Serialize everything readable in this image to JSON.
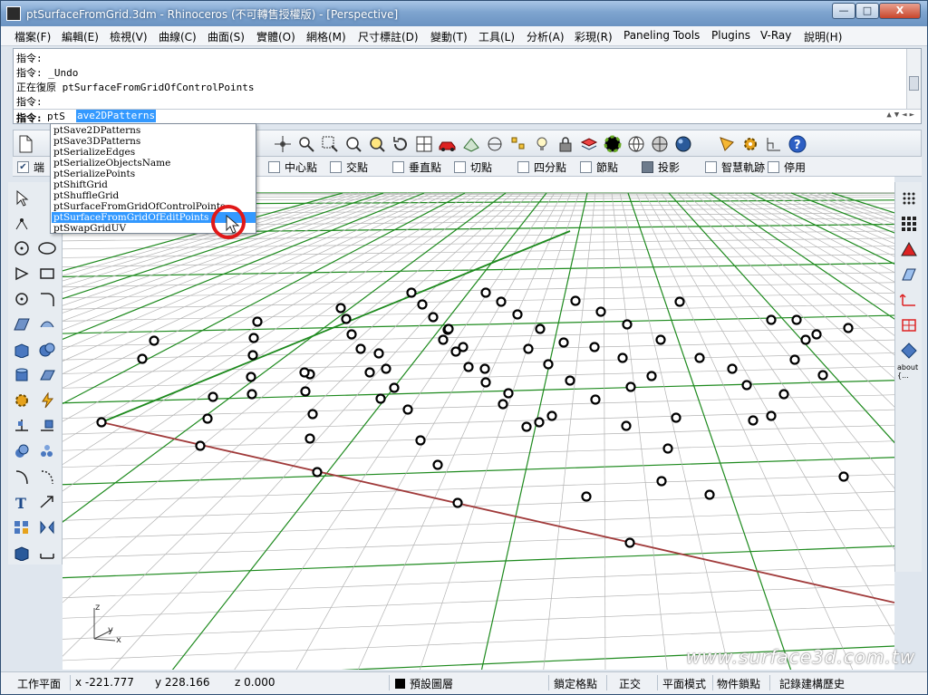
{
  "window": {
    "title": "ptSurfaceFromGrid.3dm - Rhinoceros (不可轉售授權版) - [Perspective]",
    "minimize": "—",
    "maximize": "□",
    "close": "X"
  },
  "menu": [
    "檔案(F)",
    "編輯(E)",
    "檢視(V)",
    "曲線(C)",
    "曲面(S)",
    "實體(O)",
    "網格(M)",
    "尺寸標註(D)",
    "變動(T)",
    "工具(L)",
    "分析(A)",
    "彩現(R)",
    "Paneling Tools",
    "Plugins",
    "V-Ray",
    "說明(H)"
  ],
  "command_history": [
    "指令:",
    "指令: _Undo",
    "正在復原 ptSurfaceFromGridOfControlPoints",
    "指令:"
  ],
  "command_line": {
    "prompt": "指令:",
    "typed": "ptS",
    "selected": "ave2DPatterns"
  },
  "autocomplete": {
    "items": [
      "ptSave2DPatterns",
      "ptSave3DPatterns",
      "ptSerializeEdges",
      "ptSerializeObjectsName",
      "ptSerializePoints",
      "ptShiftGrid",
      "ptShuffleGrid",
      "ptSurfaceFromGridOfControlPoints",
      "ptSurfaceFromGridOfEditPoints",
      "ptSwapGridUV"
    ],
    "selected_index": 8
  },
  "osnap": {
    "end_label": "端",
    "items": [
      {
        "label": "中心點",
        "checked": false
      },
      {
        "label": "交點",
        "checked": false
      },
      {
        "label": "垂直點",
        "checked": false
      },
      {
        "label": "切點",
        "checked": false
      },
      {
        "label": "四分點",
        "checked": false
      },
      {
        "label": "節點",
        "checked": false
      },
      {
        "label": "投影",
        "checked": false
      },
      {
        "label": "智慧軌跡",
        "checked": false
      },
      {
        "label": "停用",
        "checked": false
      }
    ]
  },
  "right_toolbar": {
    "about_label": "about",
    "about_sub": "{..."
  },
  "axes": {
    "z": "z",
    "y": "y",
    "x": "x"
  },
  "watermark": "www.surface3d.com.tw",
  "status": {
    "cplane": "工作平面",
    "x": "x -221.777",
    "y": "y 228.166",
    "z": "z 0.000",
    "layer": "預設圖層",
    "grid_snap": "鎖定格點",
    "ortho": "正交",
    "planar": "平面模式",
    "osnap": "物件鎖點",
    "history": "記錄建構歷史"
  },
  "colors": {
    "grid_major": "#1e8a1e",
    "grid_minor": "#b4b4b4",
    "x_axis": "#a03a3a",
    "selection": "#3399ff"
  }
}
